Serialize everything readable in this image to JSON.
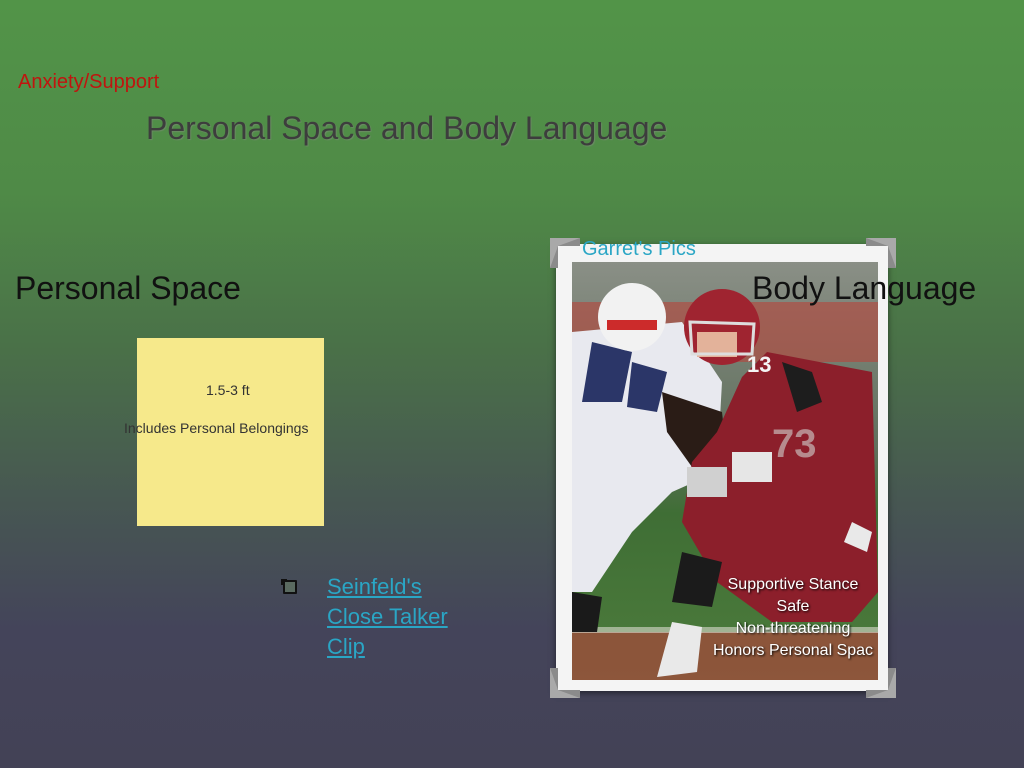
{
  "header": {
    "breadcrumb": "Anxiety/Support",
    "title": "Personal Space and Body Language"
  },
  "left": {
    "heading": "Personal Space",
    "note": {
      "line1": "1.5-3 ft",
      "line2": "Includes Personal Belongings"
    },
    "link": {
      "line1": "Seinfeld's",
      "line2": "Close Talker",
      "line3": "Clip"
    },
    "bullet_icon": "film-clip-icon"
  },
  "right": {
    "heading": "Body Language",
    "photo_label": "Garret's Pics",
    "photo_subject": "football-players-photo",
    "caption": {
      "line1": "Supportive Stance",
      "line2": "Safe",
      "line3": "Non-threatening",
      "line4": "Honors Personal Spac"
    }
  },
  "colors": {
    "breadcrumb": "#c0140f",
    "link": "#2aa6c5",
    "note": "#f6e98b"
  }
}
